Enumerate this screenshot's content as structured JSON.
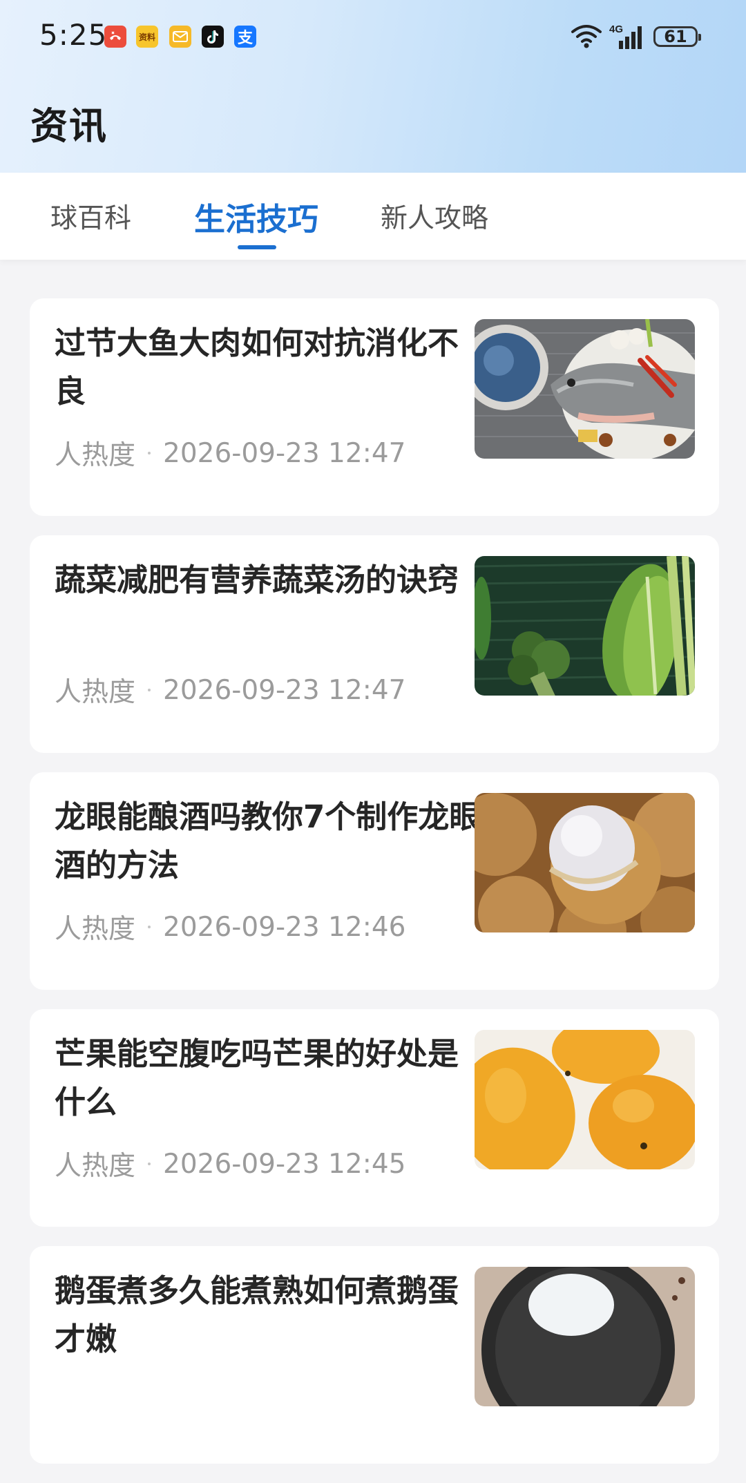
{
  "status_bar": {
    "time": "5:25",
    "network": "4G",
    "battery": "61",
    "notification_icons": [
      "missed-call-icon",
      "news-app-icon",
      "mail-icon",
      "tiktok-icon",
      "alipay-icon"
    ],
    "notification_labels": [
      "",
      "资料",
      "",
      "",
      "支"
    ]
  },
  "page": {
    "title": "资讯"
  },
  "tabs": [
    {
      "label": "球百科",
      "active": false
    },
    {
      "label": "生活技巧",
      "active": true
    },
    {
      "label": "新人攻略",
      "active": false
    }
  ],
  "articles": [
    {
      "title": "过节大鱼大肉如何对抗消化不良",
      "source": "人热度",
      "time": "2026-09-23 12:47",
      "thumbnail": "fish-dish-image"
    },
    {
      "title": "蔬菜减肥有营养蔬菜汤的诀窍",
      "source": "人热度",
      "time": "2026-09-23 12:47",
      "thumbnail": "vegetables-image"
    },
    {
      "title": "龙眼能酿酒吗教你7个制作龙眼酒的方法",
      "source": "人热度",
      "time": "2026-09-23 12:46",
      "thumbnail": "longan-image"
    },
    {
      "title": "芒果能空腹吃吗芒果的好处是什么",
      "source": "人热度",
      "time": "2026-09-23 12:45",
      "thumbnail": "mango-image"
    },
    {
      "title": "鹅蛋煮多久能煮熟如何煮鹅蛋才嫩",
      "source": "",
      "time": "",
      "thumbnail": "goose-egg-image"
    }
  ],
  "colors": {
    "accent": "#1b6fd0",
    "header_gradient_start": "#e6f1fd",
    "header_gradient_end": "#b3d6f7",
    "page_background": "#f4f4f6",
    "meta_text": "#9b9b9b"
  }
}
